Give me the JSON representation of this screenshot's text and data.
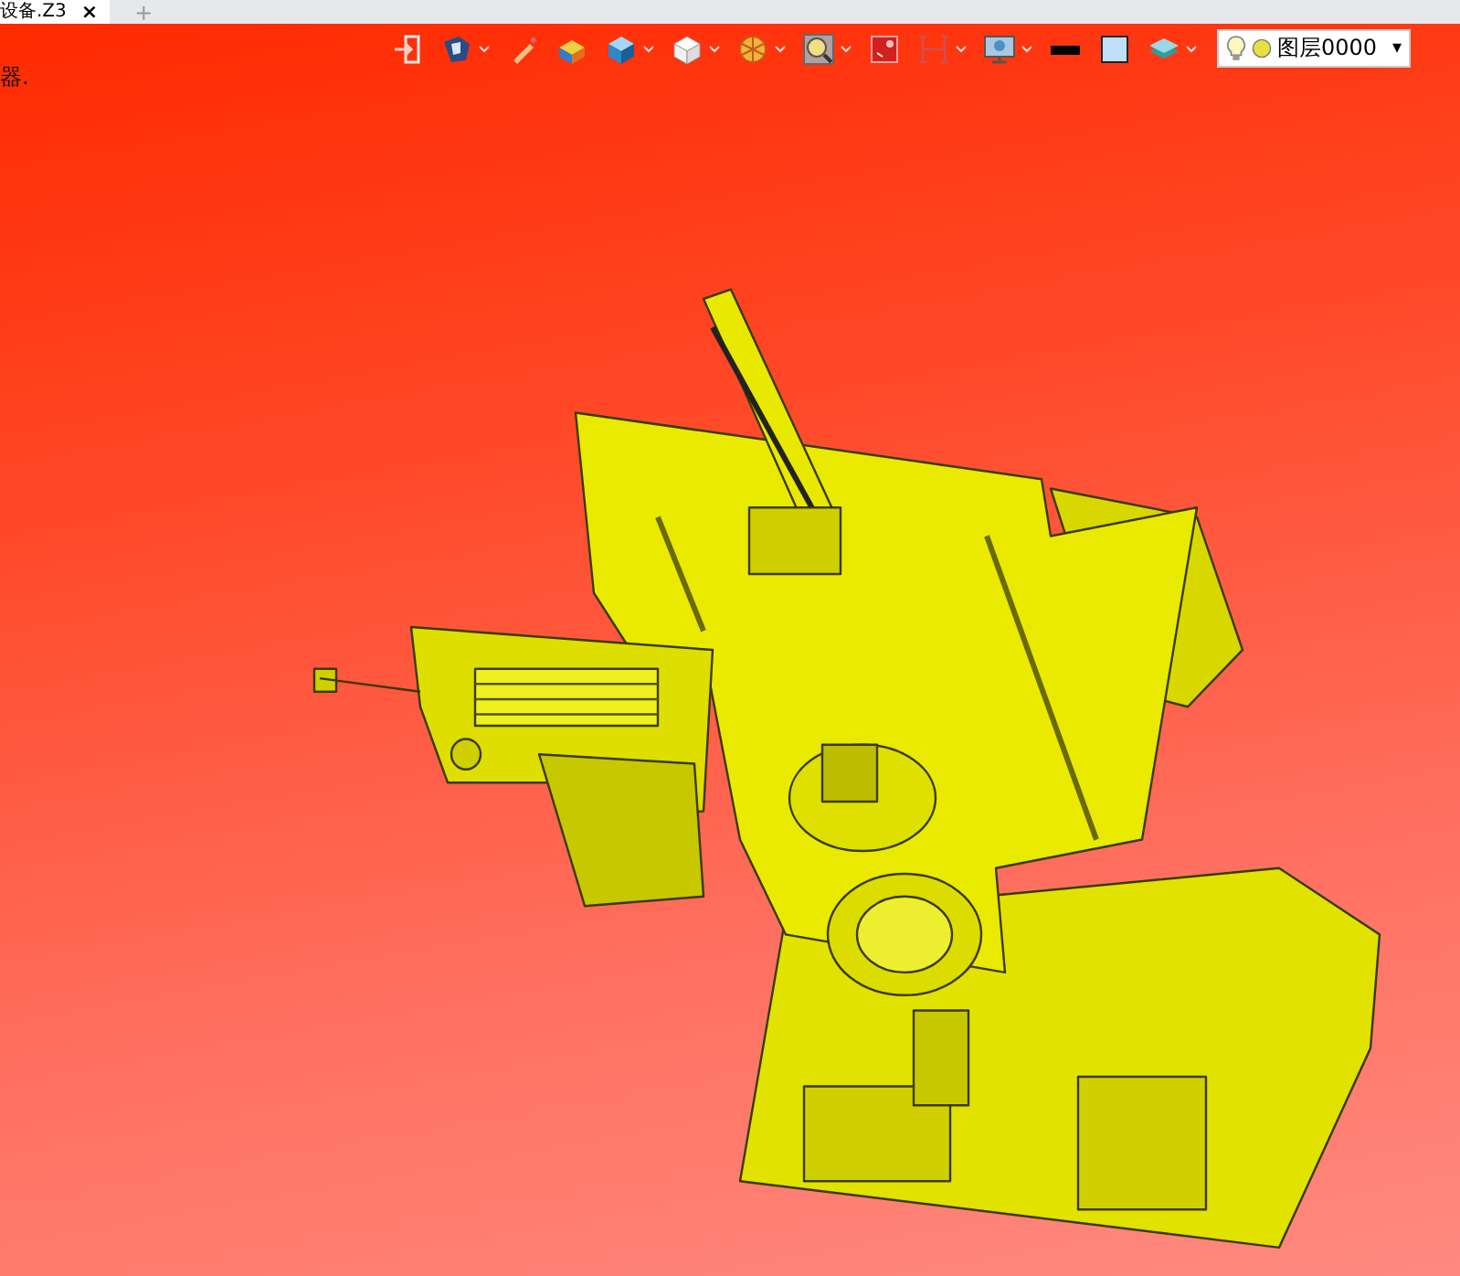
{
  "tabs": [
    {
      "label": "设备.Z3",
      "selected": true,
      "close": "×"
    }
  ],
  "new_tab": "+",
  "hint": "器.",
  "toolbar": [
    {
      "kind": "exit",
      "dropdown": false
    },
    {
      "kind": "view",
      "dropdown": true
    },
    {
      "kind": "pen",
      "dropdown": false
    },
    {
      "kind": "box-color",
      "dropdown": false
    },
    {
      "kind": "cube-shaded",
      "dropdown": true
    },
    {
      "kind": "cube-white",
      "dropdown": true
    },
    {
      "kind": "section",
      "dropdown": true
    },
    {
      "kind": "zoom",
      "dropdown": true
    },
    {
      "kind": "frame",
      "dropdown": false
    },
    {
      "kind": "bracket",
      "dropdown": true
    },
    {
      "kind": "monitor",
      "dropdown": true
    },
    {
      "kind": "line",
      "dropdown": false
    },
    {
      "kind": "fill",
      "dropdown": false
    },
    {
      "kind": "layers",
      "dropdown": true
    }
  ],
  "layer": {
    "value": "图层0000",
    "arrow": "▾"
  }
}
